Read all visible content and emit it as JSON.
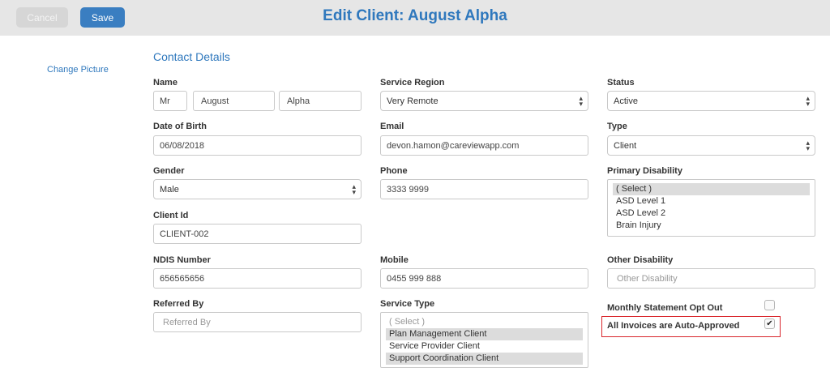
{
  "header": {
    "cancel_label": "Cancel",
    "save_label": "Save",
    "title": "Edit Client: August Alpha"
  },
  "sidebar": {
    "change_picture_label": "Change Picture"
  },
  "section": {
    "title": "Contact Details"
  },
  "fields": {
    "name": {
      "label": "Name",
      "title": "Mr",
      "first": "August",
      "last": "Alpha"
    },
    "dob": {
      "label": "Date of Birth",
      "value": "06/08/2018"
    },
    "gender": {
      "label": "Gender",
      "value": "Male"
    },
    "client_id": {
      "label": "Client Id",
      "value": "CLIENT-002"
    },
    "ndis": {
      "label": "NDIS Number",
      "value": "656565656"
    },
    "referred_by": {
      "label": "Referred By",
      "placeholder": "Referred By"
    },
    "service_region": {
      "label": "Service Region",
      "value": "Very Remote"
    },
    "email": {
      "label": "Email",
      "value": "devon.hamon@careviewapp.com"
    },
    "phone": {
      "label": "Phone",
      "value": "3333 9999"
    },
    "mobile": {
      "label": "Mobile",
      "value": "0455 999 888"
    },
    "service_type": {
      "label": "Service Type",
      "options": [
        {
          "text": "( Select )",
          "selected": false,
          "muted": true
        },
        {
          "text": "Plan Management Client",
          "selected": true,
          "muted": false
        },
        {
          "text": "Service Provider Client",
          "selected": false,
          "muted": false
        },
        {
          "text": "Support Coordination Client",
          "selected": true,
          "muted": false
        }
      ]
    },
    "status": {
      "label": "Status",
      "value": "Active"
    },
    "type": {
      "label": "Type",
      "value": "Client"
    },
    "primary_disability": {
      "label": "Primary Disability",
      "options": [
        {
          "text": "( Select )",
          "selected": true,
          "muted": false
        },
        {
          "text": "ASD Level 1",
          "selected": false,
          "muted": false
        },
        {
          "text": "ASD Level 2",
          "selected": false,
          "muted": false
        },
        {
          "text": "Brain Injury",
          "selected": false,
          "muted": false
        }
      ]
    },
    "other_disability": {
      "label": "Other Disability",
      "placeholder": "Other Disability"
    },
    "monthly_statement": {
      "label": "Monthly Statement Opt Out",
      "checked": false
    },
    "auto_approved": {
      "label": "All Invoices are Auto-Approved",
      "checked": true
    }
  },
  "colors": {
    "accent": "#2f78bd",
    "save_button": "#3a7ec1",
    "highlight_border": "#d9262c"
  }
}
